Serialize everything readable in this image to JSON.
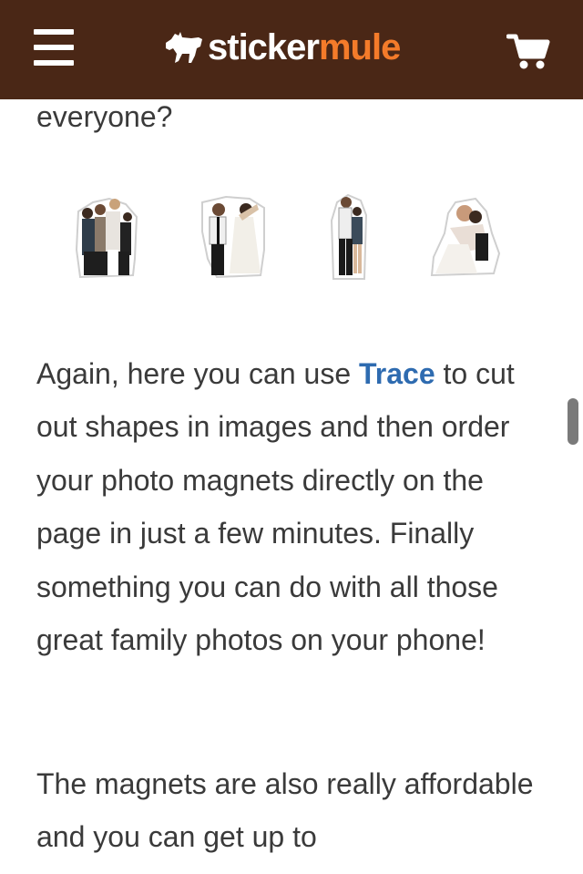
{
  "header": {
    "logo_part1": "sticker",
    "logo_part2": "mule",
    "menu_icon": "hamburger-menu-icon",
    "cart_icon": "shopping-cart-icon",
    "colors": {
      "background": "#4a2716",
      "logo_accent": "#f47b2a",
      "logo_text": "#ffffff"
    }
  },
  "article": {
    "previous_line": "everyone?",
    "paragraph1": {
      "before_link": "Again, here you can use ",
      "link_text": "Trace",
      "after_link": " to cut out shapes in images and then order your photo magnets directly on the page in just a few minutes. Finally something you can do with all those great family photos on your phone!"
    },
    "paragraph2": "The magnets are also really affordable and you can get up to",
    "link_color": "#2e6bb0"
  },
  "stickers": [
    {
      "name": "group-photo-sticker"
    },
    {
      "name": "couple-photo-sticker"
    },
    {
      "name": "standing-couple-sticker"
    },
    {
      "name": "hugging-couple-sticker"
    }
  ]
}
